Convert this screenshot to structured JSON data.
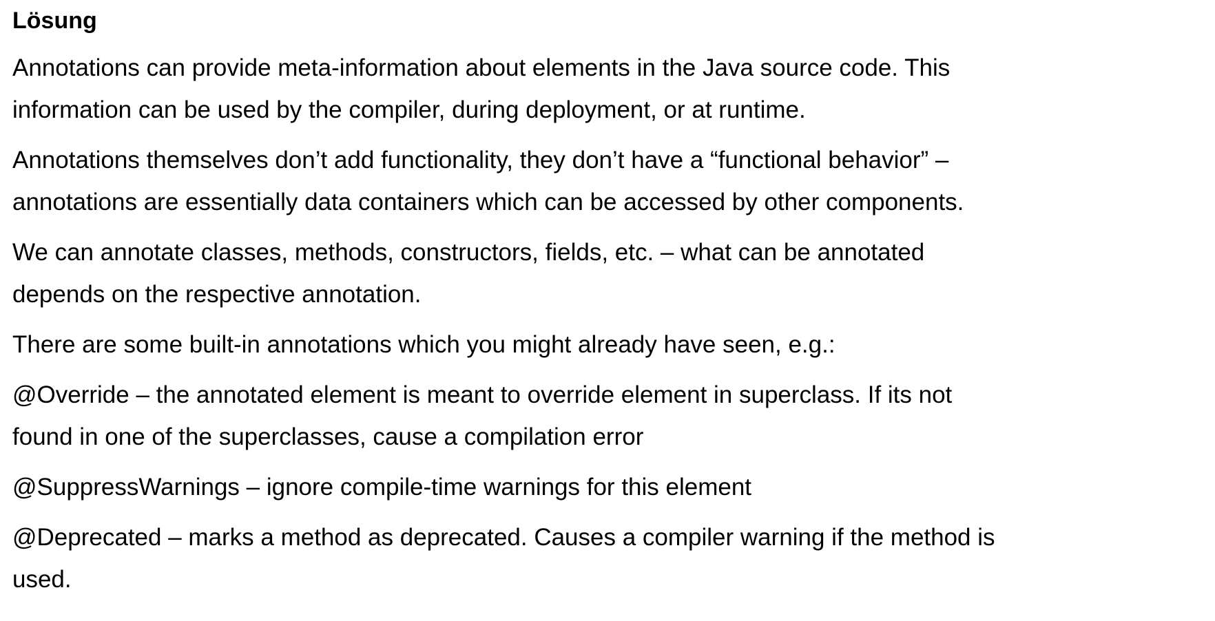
{
  "document": {
    "heading": "Lösung",
    "paragraphs": [
      {
        "lines": [
          "Annotations can provide meta-information about elements in the Java source code. This",
          "information can be used by the compiler, during deployment, or at runtime."
        ]
      },
      {
        "lines": [
          "Annotations themselves don’t add functionality, they don’t have a “functional behavior” –",
          "annotations are essentially data containers which can be accessed by other components."
        ]
      },
      {
        "lines": [
          "We can annotate classes, methods, constructors, fields, etc. – what can be annotated",
          "depends on the respective annotation."
        ]
      },
      {
        "lines": [
          "There are some built-in annotations which you might already have seen, e.g.:"
        ]
      },
      {
        "lines": [
          "@Override – the annotated element is meant to override element in superclass. If its not",
          "found in one of the superclasses, cause a compilation error"
        ]
      },
      {
        "lines": [
          "@SuppressWarnings – ignore compile-time warnings for this element"
        ]
      },
      {
        "lines": [
          "@Deprecated – marks a method as deprecated. Causes a compiler warning if the method is",
          "used."
        ]
      }
    ]
  }
}
